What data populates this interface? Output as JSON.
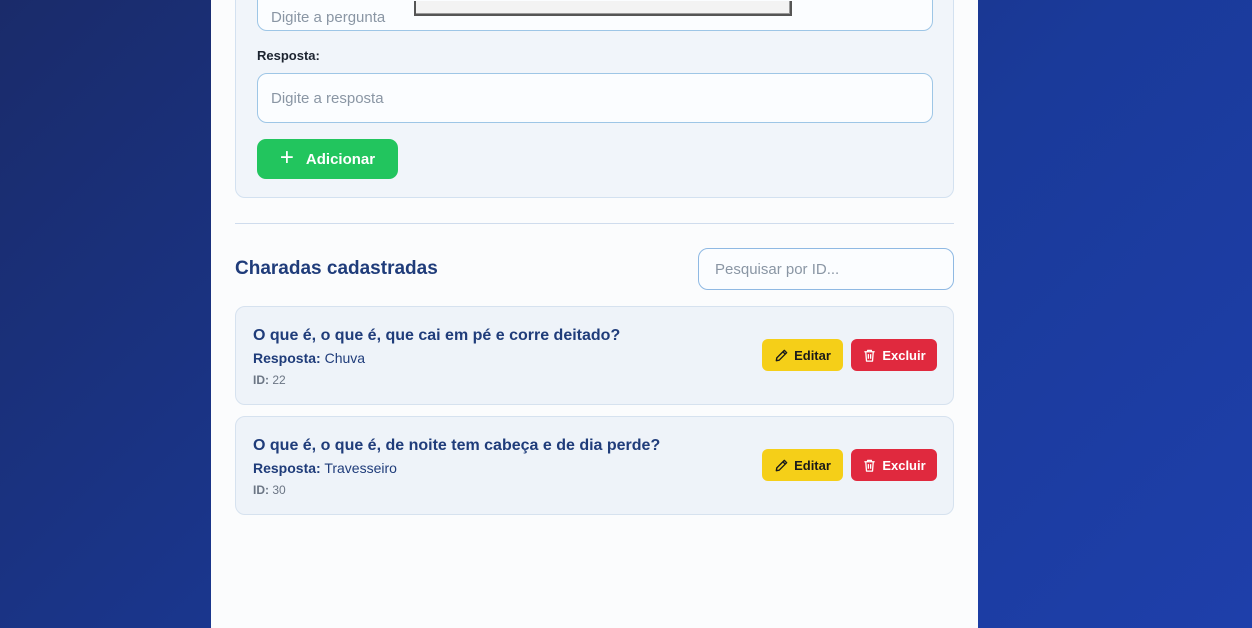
{
  "form": {
    "question_placeholder": "Digite a pergunta",
    "answer_label": "Resposta:",
    "answer_placeholder": "Digite a resposta",
    "add_button": "Adicionar"
  },
  "list": {
    "title": "Charadas cadastradas",
    "search_placeholder": "Pesquisar por ID...",
    "answer_prefix": "Resposta:",
    "id_prefix": "ID:",
    "edit_label": "Editar",
    "delete_label": "Excluir",
    "items": [
      {
        "question": "O que é, o que é, que cai em pé e corre deitado?",
        "answer": "Chuva",
        "id": "22"
      },
      {
        "question": "O que é, o que é, de noite tem cabeça e de dia perde?",
        "answer": "Travesseiro",
        "id": "30"
      }
    ]
  },
  "colors": {
    "add": "#22c55e",
    "edit": "#f5cf18",
    "delete": "#e0293e",
    "title": "#1f3c7a"
  },
  "icons": {
    "add": "plus-icon",
    "edit": "pencil-icon",
    "delete": "trash-icon"
  }
}
